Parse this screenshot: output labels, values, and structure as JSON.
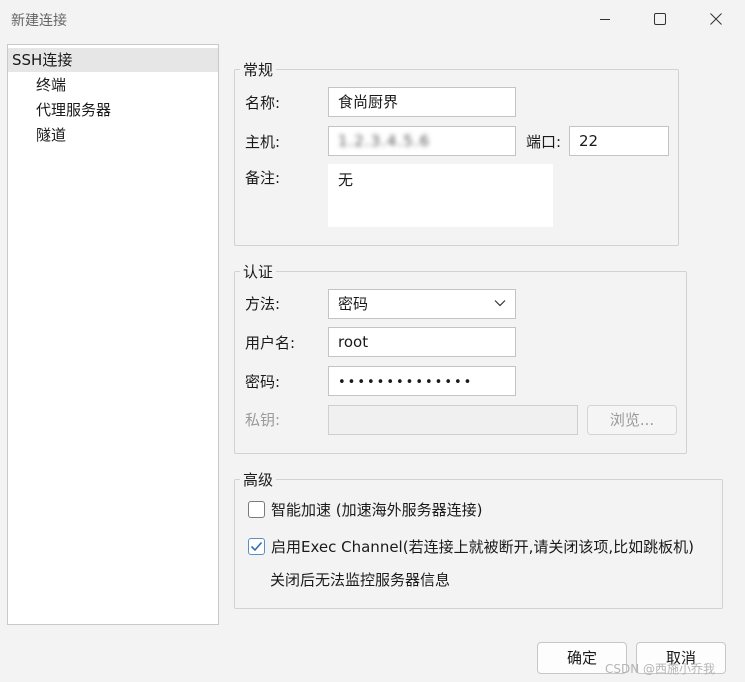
{
  "window": {
    "title": "新建连接",
    "controls": {
      "minimize": "minimize-icon",
      "maximize": "maximize-icon",
      "close": "close-icon"
    }
  },
  "sidebar": {
    "items": [
      {
        "label": "SSH连接",
        "selected": true
      },
      {
        "label": "终端"
      },
      {
        "label": "代理服务器"
      },
      {
        "label": "隧道"
      }
    ]
  },
  "general": {
    "legend": "常规",
    "name_label": "名称:",
    "name_value": "食尚厨界",
    "host_label": "主机:",
    "host_value": "1.2.3.4.5.6",
    "port_label": "端口:",
    "port_value": "22",
    "note_label": "备注:",
    "note_value": "无"
  },
  "auth": {
    "legend": "认证",
    "method_label": "方法:",
    "method_value": "密码",
    "user_label": "用户名:",
    "user_value": "root",
    "password_label": "密码:",
    "password_value": "••••••••••••••",
    "key_label": "私钥:",
    "key_value": "",
    "browse_label": "浏览..."
  },
  "advanced": {
    "legend": "高级",
    "smart_accel_label": "智能加速 (加速海外服务器连接)",
    "smart_accel_checked": false,
    "exec_channel_label": "启用Exec Channel(若连接上就被断开,请关闭该项,比如跳板机)",
    "exec_channel_checked": true,
    "exec_channel_note": "关闭后无法监控服务器信息"
  },
  "footer": {
    "ok_label": "确定",
    "cancel_label": "取消",
    "watermark": "CSDN @西施小乔我"
  },
  "colors": {
    "accent": "#5a8ec9",
    "background": "#f3f3f3"
  }
}
